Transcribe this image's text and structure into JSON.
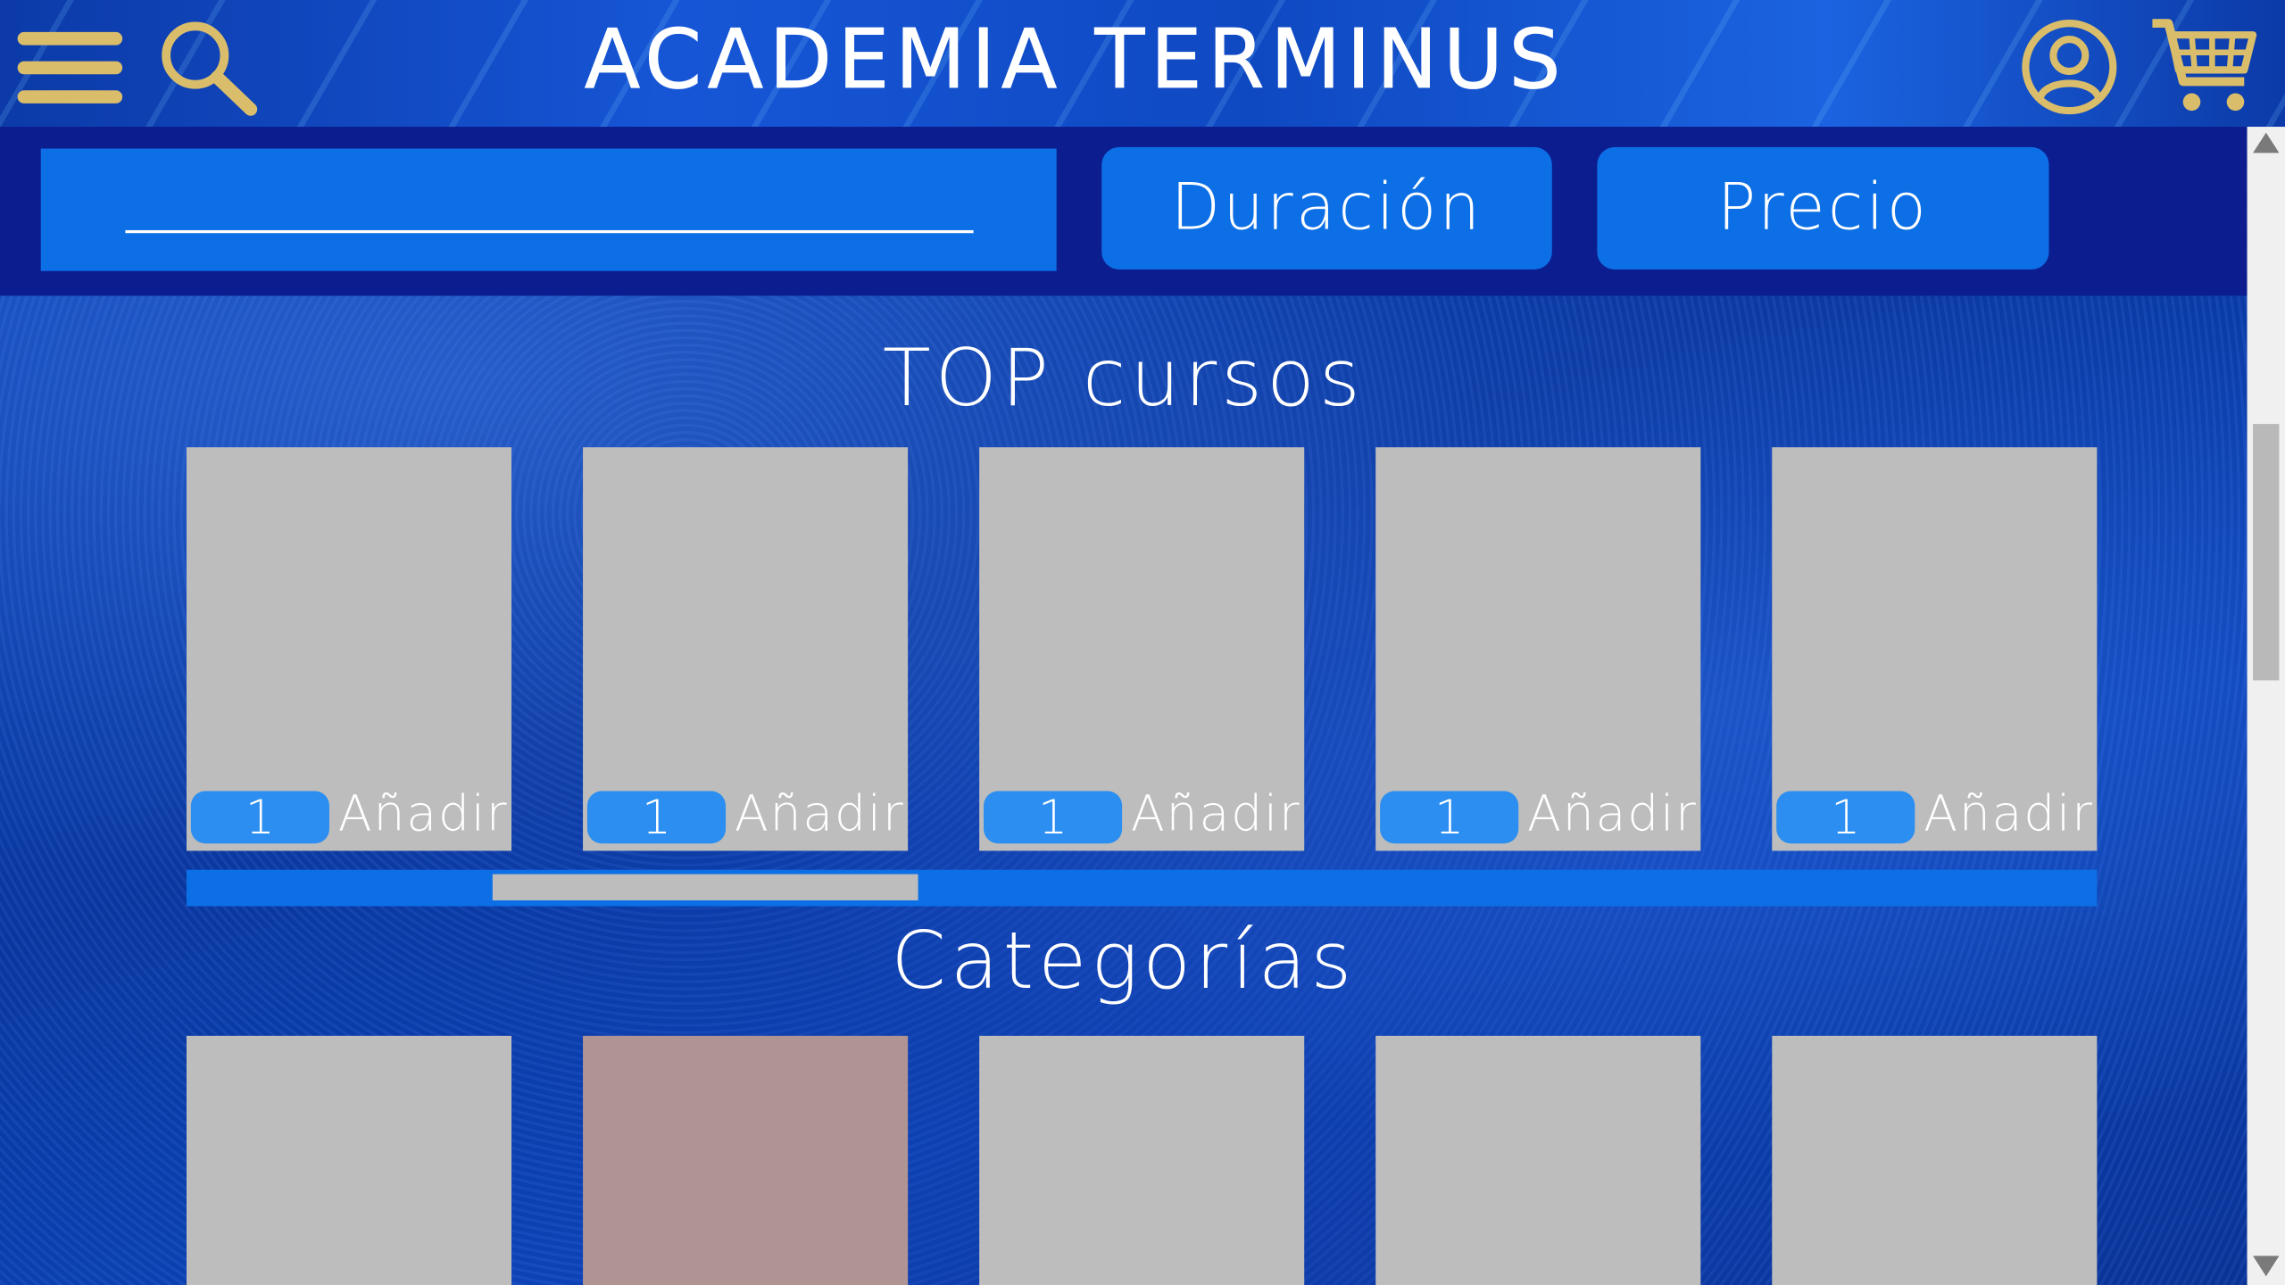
{
  "header": {
    "title": "ACADEMIA TERMINUS",
    "menu_icon": "hamburger-menu-icon",
    "search_icon": "magnifier-icon",
    "user_icon": "user-account-icon",
    "cart_icon": "shopping-cart-icon",
    "icon_color": "#d9bd6a"
  },
  "filters": {
    "search_value": "",
    "duration_label": "Duración",
    "price_label": "Precio"
  },
  "top_courses": {
    "title": "TOP cursos",
    "items": [
      {
        "quantity": "1",
        "add_label": "Añadir"
      },
      {
        "quantity": "1",
        "add_label": "Añadir"
      },
      {
        "quantity": "1",
        "add_label": "Añadir"
      },
      {
        "quantity": "1",
        "add_label": "Añadir"
      },
      {
        "quantity": "1",
        "add_label": "Añadir"
      }
    ]
  },
  "categories": {
    "title": "Categorías",
    "items": [
      {
        "color": "#bdbdbd"
      },
      {
        "color": "#b09494"
      },
      {
        "color": "#bdbdbd"
      },
      {
        "color": "#bdbdbd"
      },
      {
        "color": "#bdbdbd"
      }
    ]
  },
  "colors": {
    "accent_blue": "#0d6fe6",
    "filter_bar": "#0b1d8f",
    "card_gray": "#bdbdbd"
  }
}
